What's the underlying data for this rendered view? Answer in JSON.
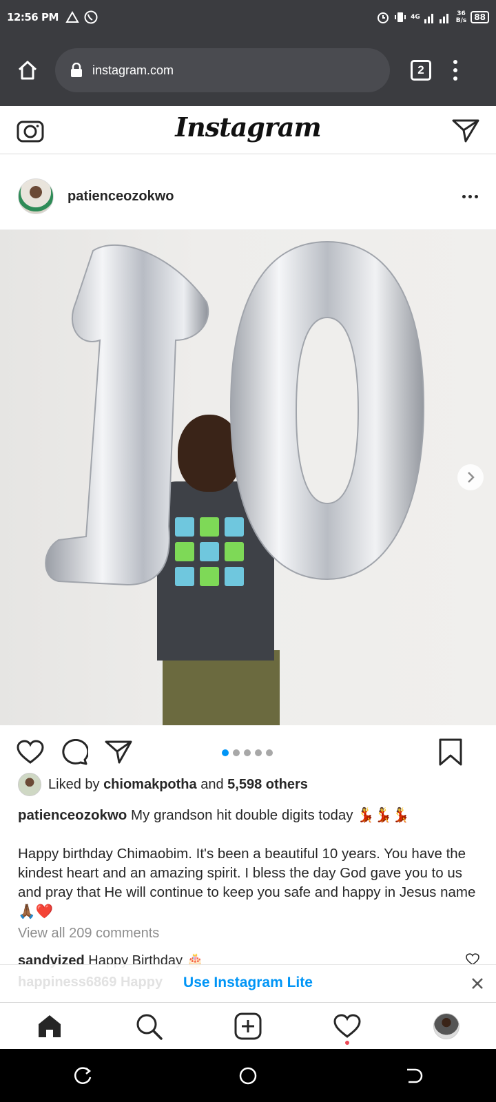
{
  "status_bar": {
    "time": "12:56 PM",
    "network_label": "4G",
    "speed_value": "36",
    "speed_unit": "B/s",
    "battery": "88"
  },
  "browser": {
    "url": "instagram.com",
    "tab_count": "2"
  },
  "instagram": {
    "logo": "Instagram"
  },
  "post": {
    "username": "patienceozokwo",
    "carousel": {
      "total": 5,
      "active": 1
    },
    "likes": {
      "prefix": "Liked by",
      "liker": "chiomakpotha",
      "joiner": "and",
      "others": "5,598 others"
    },
    "caption": {
      "author": "patienceozokwo",
      "line1": "My grandson hit double digits today 💃💃💃",
      "body": "Happy birthday Chimaobim. It's been a beautiful 10 years. You have the kindest heart and an amazing spirit. I bless the day God gave you to us and pray that He will continue to keep you safe and happy in Jesus name 🙏🏾❤️"
    },
    "view_all_comments": "View all 209 comments",
    "comment_preview": {
      "user": "sandyized",
      "text": "Happy Birthday 🎂"
    },
    "comment_preview_2": {
      "user": "happiness6869",
      "text": "Happy"
    }
  },
  "lite_banner": {
    "label": "Use Instagram Lite"
  },
  "colors": {
    "accent": "#0095f6",
    "chrome_bar": "#3b3c40",
    "notification": "#ed4956"
  }
}
